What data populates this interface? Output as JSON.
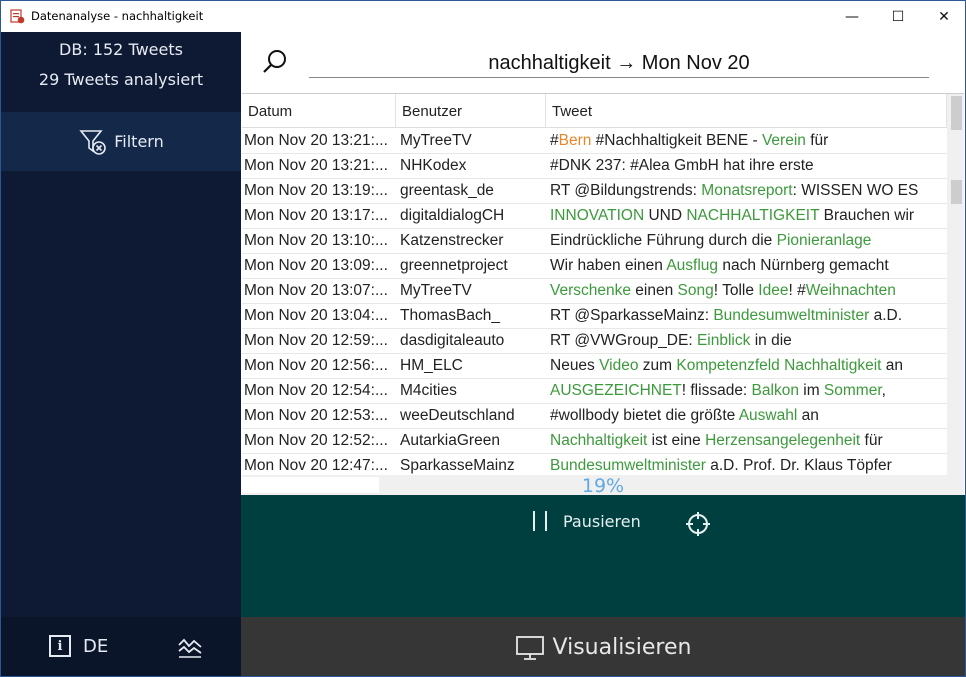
{
  "window": {
    "title": "Datenanalyse - nachhaltigkeit",
    "controls": {
      "minimize": "—",
      "maximize": "☐",
      "close": "✕"
    }
  },
  "sidebar": {
    "db_count": "DB: 152 Tweets",
    "analyzed": "29 Tweets analysiert",
    "filter_label": "Filtern",
    "language": "DE"
  },
  "search": {
    "query": "nachhaltigkeit → Mon Nov 20"
  },
  "table": {
    "columns": [
      "Datum",
      "Benutzer",
      "Tweet"
    ],
    "rows": [
      {
        "date": "Mon Nov 20 13:21:...",
        "user": "MyTreeTV",
        "tweet": [
          [
            "#",
            ""
          ],
          [
            "Bern",
            "o"
          ],
          [
            " #Nachhaltigkeit BENE - ",
            ""
          ],
          [
            "Verein",
            "g"
          ],
          [
            " für",
            ""
          ]
        ]
      },
      {
        "date": "Mon Nov 20 13:21:...",
        "user": "NHKodex",
        "tweet": [
          [
            "#DNK 237: #Alea GmbH hat ihre erste",
            ""
          ]
        ]
      },
      {
        "date": "Mon Nov 20 13:19:...",
        "user": "greentask_de",
        "tweet": [
          [
            "RT @Bildungstrends: ",
            ""
          ],
          [
            "Monatsreport",
            "g"
          ],
          [
            ": WISSEN WO ES",
            ""
          ]
        ]
      },
      {
        "date": "Mon Nov 20 13:17:...",
        "user": "digitaldialogCH",
        "tweet": [
          [
            "INNOVATION",
            "g"
          ],
          [
            " UND ",
            ""
          ],
          [
            "NACHHALTIGKEIT",
            "g"
          ],
          [
            " Brauchen wir",
            ""
          ]
        ]
      },
      {
        "date": "Mon Nov 20 13:10:...",
        "user": "Katzenstrecker",
        "tweet": [
          [
            "Eindrückliche Führung durch die ",
            ""
          ],
          [
            "Pionieranlage",
            "g"
          ]
        ]
      },
      {
        "date": "Mon Nov 20 13:09:...",
        "user": "greennetproject",
        "tweet": [
          [
            "Wir haben einen ",
            ""
          ],
          [
            "Ausflug",
            "g"
          ],
          [
            " nach Nürnberg gemacht",
            ""
          ]
        ]
      },
      {
        "date": "Mon Nov 20 13:07:...",
        "user": "MyTreeTV",
        "tweet": [
          [
            "Verschenke",
            "g"
          ],
          [
            " einen ",
            ""
          ],
          [
            "Song",
            "g"
          ],
          [
            "! Tolle ",
            ""
          ],
          [
            "Idee",
            "g"
          ],
          [
            "! #",
            ""
          ],
          [
            "Weihnachten",
            "g"
          ]
        ]
      },
      {
        "date": "Mon Nov 20 13:04:...",
        "user": "ThomasBach_",
        "tweet": [
          [
            "RT @SparkasseMainz: ",
            ""
          ],
          [
            "Bundesumweltminister",
            "g"
          ],
          [
            " a.D.",
            ""
          ]
        ]
      },
      {
        "date": "Mon Nov 20 12:59:...",
        "user": "dasdigitaleauto",
        "tweet": [
          [
            "RT @VWGroup_DE: ",
            ""
          ],
          [
            "Einblick",
            "g"
          ],
          [
            " in die",
            ""
          ]
        ]
      },
      {
        "date": "Mon Nov 20 12:56:...",
        "user": "HM_ELC",
        "tweet": [
          [
            "Neues ",
            ""
          ],
          [
            "Video",
            "g"
          ],
          [
            " zum ",
            ""
          ],
          [
            "Kompetenzfeld",
            "g"
          ],
          [
            " ",
            ""
          ],
          [
            "Nachhaltigkeit",
            "g"
          ],
          [
            " an",
            ""
          ]
        ]
      },
      {
        "date": "Mon Nov 20 12:54:...",
        "user": "M4cities",
        "tweet": [
          [
            "AUSGEZEICHNET",
            "g"
          ],
          [
            "! flissade: ",
            ""
          ],
          [
            "Balkon",
            "g"
          ],
          [
            " im ",
            ""
          ],
          [
            "Sommer",
            "g"
          ],
          [
            ",",
            ""
          ]
        ]
      },
      {
        "date": "Mon Nov 20 12:53:...",
        "user": "weeDeutschland",
        "tweet": [
          [
            "#wollbody bietet die größte ",
            ""
          ],
          [
            "Auswahl",
            "g"
          ],
          [
            " an",
            ""
          ]
        ]
      },
      {
        "date": "Mon Nov 20 12:52:...",
        "user": "AutarkiaGreen",
        "tweet": [
          [
            "Nachhaltigkeit",
            "g"
          ],
          [
            " ist eine ",
            ""
          ],
          [
            "Herzensangelegenheit",
            "g"
          ],
          [
            " für",
            ""
          ]
        ]
      },
      {
        "date": "Mon Nov 20 12:47:...",
        "user": "SparkasseMainz",
        "tweet": [
          [
            "Bundesumweltminister",
            "g"
          ],
          [
            " a.D. Prof. Dr. Klaus Töpfer",
            ""
          ]
        ]
      }
    ]
  },
  "progress": {
    "text": "19%",
    "value": 0.19
  },
  "controls": {
    "pause_label": "Pausieren"
  },
  "visualize": {
    "label": "Visualisieren"
  },
  "colors": {
    "sidebar": "#0e1a33",
    "filter_bg": "#14284a",
    "controls_bg": "#003f3f",
    "visualize_bg": "#363636",
    "positive_word": "#3c9a3c",
    "negative_word": "#e5872a",
    "progress_text": "#62a9e0"
  },
  "icons": [
    "app-icon",
    "search-icon",
    "filter-remove-icon",
    "info-icon",
    "chart-wave-icon",
    "pause-icon",
    "target-icon",
    "monitor-icon"
  ]
}
